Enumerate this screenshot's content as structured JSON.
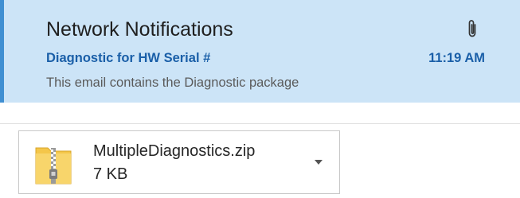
{
  "email": {
    "sender": "Network Notifications",
    "subject": "Diagnostic for HW Serial #",
    "time": "11:19 AM",
    "preview": "This email contains the Diagnostic package",
    "attachment_icon": "paperclip-icon"
  },
  "attachment": {
    "filename": "MultipleDiagnostics.zip",
    "size": "7 KB",
    "file_icon": "zip-folder-icon",
    "menu_icon": "chevron-down-icon"
  },
  "colors": {
    "selected_background": "#cce4f7",
    "selected_border": "#3f8fd2",
    "subject_text": "#1a5fa8",
    "folder_yellow": "#f4c64a"
  }
}
